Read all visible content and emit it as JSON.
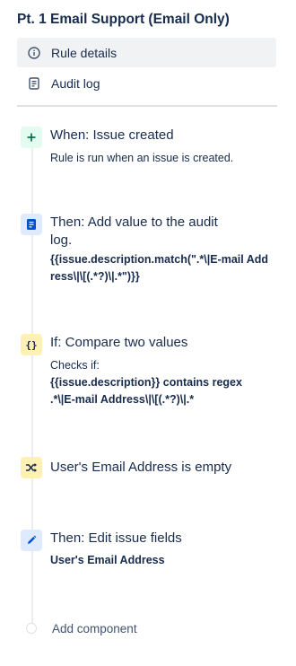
{
  "title": "Pt. 1 Email Support (Email Only)",
  "nav": {
    "rule_details": "Rule details",
    "audit_log": "Audit log"
  },
  "components": [
    {
      "kind": "trigger",
      "icon": "plus-icon",
      "color": "#e3fcef",
      "heading": "When: Issue created",
      "description": "Rule is run when an issue is created."
    },
    {
      "kind": "action",
      "icon": "audit-log-icon",
      "color": "#deebff",
      "heading": "Then: Add value to the audit log.",
      "code": "{{issue.description.match(\".*\\|E-mail Address\\|\\[(.*?)\\|.*\")}}"
    },
    {
      "kind": "condition",
      "icon": "braces-icon",
      "color": "#fff0b3",
      "heading": "If: Compare two values",
      "checks_label": "Checks if:",
      "code": "{{issue.description}} contains regex .*\\|E-mail Address\\|\\[(.*?)\\|.*"
    },
    {
      "kind": "branch",
      "icon": "shuffle-icon",
      "color": "#fff0b3",
      "heading": "User's Email Address is empty"
    },
    {
      "kind": "action",
      "icon": "pencil-icon",
      "color": "#deebff",
      "heading": "Then: Edit issue fields",
      "code": "User's Email Address"
    }
  ],
  "add_component": "Add component"
}
